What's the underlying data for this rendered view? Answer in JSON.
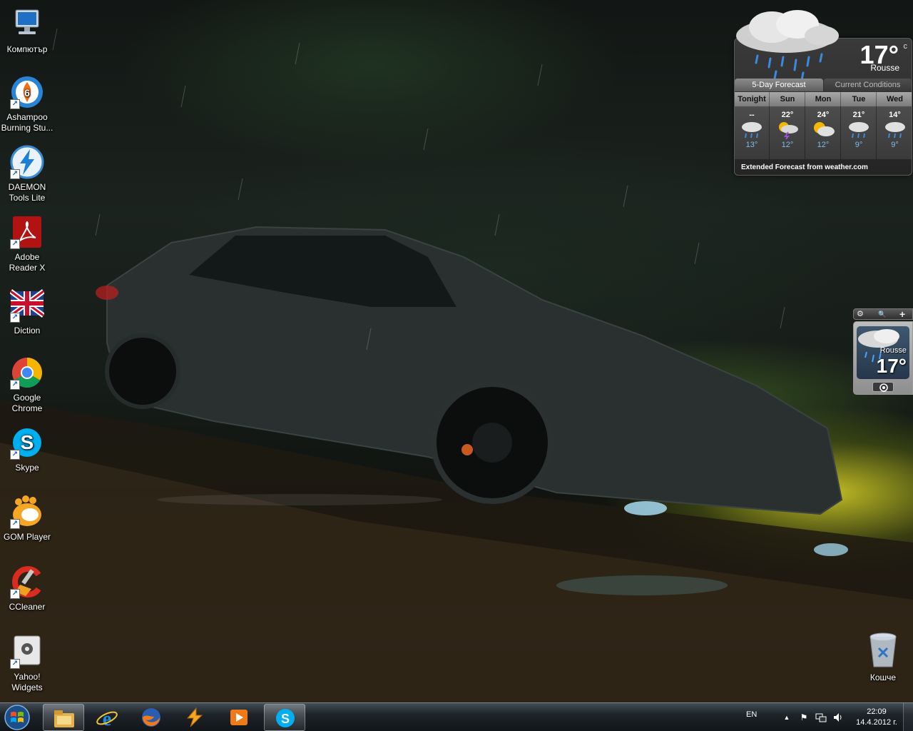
{
  "desktop": {
    "icons": [
      {
        "label": "Компютър",
        "icon": "computer-icon"
      },
      {
        "label": "Ashampoo Burning Stu...",
        "icon": "ashampoo-burning-studio-icon"
      },
      {
        "label": "DAEMON Tools Lite",
        "icon": "daemon-tools-icon"
      },
      {
        "label": "Adobe Reader X",
        "icon": "adobe-reader-icon"
      },
      {
        "label": "Diction",
        "icon": "uk-flag-icon"
      },
      {
        "label": "Google Chrome",
        "icon": "chrome-icon"
      },
      {
        "label": "Skype",
        "icon": "skype-icon"
      },
      {
        "label": "GOM Player",
        "icon": "gom-player-icon"
      },
      {
        "label": "CCleaner",
        "icon": "ccleaner-icon"
      },
      {
        "label": "Yahoo! Widgets",
        "icon": "yahoo-widgets-icon"
      }
    ],
    "recycle_bin": {
      "label": "Кошче",
      "icon": "recycle-bin-icon"
    }
  },
  "weather_widget": {
    "temperature": "17°",
    "unit": "c",
    "city": "Rousse",
    "tabs": [
      "5-Day Forecast",
      "Current Conditions"
    ],
    "active_tab": "5-Day Forecast",
    "days": [
      {
        "name": "Tonight",
        "high": "--",
        "low": "13°",
        "icon": "rain-icon"
      },
      {
        "name": "Sun",
        "high": "22°",
        "low": "12°",
        "icon": "thunderstorm-icon"
      },
      {
        "name": "Mon",
        "high": "24°",
        "low": "12°",
        "icon": "partly-sunny-icon"
      },
      {
        "name": "Tue",
        "high": "21°",
        "low": "9°",
        "icon": "rain-icon"
      },
      {
        "name": "Wed",
        "high": "14°",
        "low": "9°",
        "icon": "rain-icon"
      }
    ],
    "footer": "Extended Forecast from weather.com"
  },
  "gadget_sidebar": {
    "toolbar": {
      "settings": "⚙",
      "search": "🔍",
      "add": "+"
    },
    "mini_weather": {
      "city": "Rousse",
      "temperature": "17°"
    }
  },
  "taskbar": {
    "pinned": [
      "file-explorer-icon",
      "internet-explorer-icon",
      "firefox-icon",
      "winamp-icon",
      "media-player-icon",
      "skype-icon"
    ],
    "open_apps": [
      "file-explorer-icon",
      "skype-icon"
    ],
    "language": "EN",
    "clock": {
      "time": "22:09",
      "date": "14.4.2012 г."
    }
  },
  "colors": {
    "accent_blue": "#1e7fd8",
    "weather_low": "#7fbde8",
    "sky_yellow": "#e2dc28"
  }
}
